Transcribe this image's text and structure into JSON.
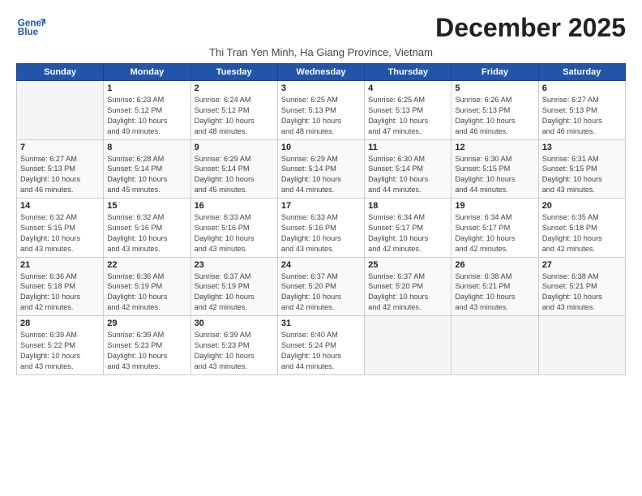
{
  "logo": {
    "line1": "General",
    "line2": "Blue"
  },
  "title": "December 2025",
  "subtitle": "Thi Tran Yen Minh, Ha Giang Province, Vietnam",
  "days_header": [
    "Sunday",
    "Monday",
    "Tuesday",
    "Wednesday",
    "Thursday",
    "Friday",
    "Saturday"
  ],
  "weeks": [
    [
      {
        "day": "",
        "info": ""
      },
      {
        "day": "1",
        "info": "Sunrise: 6:23 AM\nSunset: 5:12 PM\nDaylight: 10 hours\nand 49 minutes."
      },
      {
        "day": "2",
        "info": "Sunrise: 6:24 AM\nSunset: 5:12 PM\nDaylight: 10 hours\nand 48 minutes."
      },
      {
        "day": "3",
        "info": "Sunrise: 6:25 AM\nSunset: 5:13 PM\nDaylight: 10 hours\nand 48 minutes."
      },
      {
        "day": "4",
        "info": "Sunrise: 6:25 AM\nSunset: 5:13 PM\nDaylight: 10 hours\nand 47 minutes."
      },
      {
        "day": "5",
        "info": "Sunrise: 6:26 AM\nSunset: 5:13 PM\nDaylight: 10 hours\nand 46 minutes."
      },
      {
        "day": "6",
        "info": "Sunrise: 6:27 AM\nSunset: 5:13 PM\nDaylight: 10 hours\nand 46 minutes."
      }
    ],
    [
      {
        "day": "7",
        "info": "Sunrise: 6:27 AM\nSunset: 5:13 PM\nDaylight: 10 hours\nand 46 minutes."
      },
      {
        "day": "8",
        "info": "Sunrise: 6:28 AM\nSunset: 5:14 PM\nDaylight: 10 hours\nand 45 minutes."
      },
      {
        "day": "9",
        "info": "Sunrise: 6:29 AM\nSunset: 5:14 PM\nDaylight: 10 hours\nand 45 minutes."
      },
      {
        "day": "10",
        "info": "Sunrise: 6:29 AM\nSunset: 5:14 PM\nDaylight: 10 hours\nand 44 minutes."
      },
      {
        "day": "11",
        "info": "Sunrise: 6:30 AM\nSunset: 5:14 PM\nDaylight: 10 hours\nand 44 minutes."
      },
      {
        "day": "12",
        "info": "Sunrise: 6:30 AM\nSunset: 5:15 PM\nDaylight: 10 hours\nand 44 minutes."
      },
      {
        "day": "13",
        "info": "Sunrise: 6:31 AM\nSunset: 5:15 PM\nDaylight: 10 hours\nand 43 minutes."
      }
    ],
    [
      {
        "day": "14",
        "info": "Sunrise: 6:32 AM\nSunset: 5:15 PM\nDaylight: 10 hours\nand 43 minutes."
      },
      {
        "day": "15",
        "info": "Sunrise: 6:32 AM\nSunset: 5:16 PM\nDaylight: 10 hours\nand 43 minutes."
      },
      {
        "day": "16",
        "info": "Sunrise: 6:33 AM\nSunset: 5:16 PM\nDaylight: 10 hours\nand 43 minutes."
      },
      {
        "day": "17",
        "info": "Sunrise: 6:33 AM\nSunset: 5:16 PM\nDaylight: 10 hours\nand 43 minutes."
      },
      {
        "day": "18",
        "info": "Sunrise: 6:34 AM\nSunset: 5:17 PM\nDaylight: 10 hours\nand 42 minutes."
      },
      {
        "day": "19",
        "info": "Sunrise: 6:34 AM\nSunset: 5:17 PM\nDaylight: 10 hours\nand 42 minutes."
      },
      {
        "day": "20",
        "info": "Sunrise: 6:35 AM\nSunset: 5:18 PM\nDaylight: 10 hours\nand 42 minutes."
      }
    ],
    [
      {
        "day": "21",
        "info": "Sunrise: 6:36 AM\nSunset: 5:18 PM\nDaylight: 10 hours\nand 42 minutes."
      },
      {
        "day": "22",
        "info": "Sunrise: 6:36 AM\nSunset: 5:19 PM\nDaylight: 10 hours\nand 42 minutes."
      },
      {
        "day": "23",
        "info": "Sunrise: 6:37 AM\nSunset: 5:19 PM\nDaylight: 10 hours\nand 42 minutes."
      },
      {
        "day": "24",
        "info": "Sunrise: 6:37 AM\nSunset: 5:20 PM\nDaylight: 10 hours\nand 42 minutes."
      },
      {
        "day": "25",
        "info": "Sunrise: 6:37 AM\nSunset: 5:20 PM\nDaylight: 10 hours\nand 42 minutes."
      },
      {
        "day": "26",
        "info": "Sunrise: 6:38 AM\nSunset: 5:21 PM\nDaylight: 10 hours\nand 43 minutes."
      },
      {
        "day": "27",
        "info": "Sunrise: 6:38 AM\nSunset: 5:21 PM\nDaylight: 10 hours\nand 43 minutes."
      }
    ],
    [
      {
        "day": "28",
        "info": "Sunrise: 6:39 AM\nSunset: 5:22 PM\nDaylight: 10 hours\nand 43 minutes."
      },
      {
        "day": "29",
        "info": "Sunrise: 6:39 AM\nSunset: 5:23 PM\nDaylight: 10 hours\nand 43 minutes."
      },
      {
        "day": "30",
        "info": "Sunrise: 6:39 AM\nSunset: 5:23 PM\nDaylight: 10 hours\nand 43 minutes."
      },
      {
        "day": "31",
        "info": "Sunrise: 6:40 AM\nSunset: 5:24 PM\nDaylight: 10 hours\nand 44 minutes."
      },
      {
        "day": "",
        "info": ""
      },
      {
        "day": "",
        "info": ""
      },
      {
        "day": "",
        "info": ""
      }
    ]
  ]
}
